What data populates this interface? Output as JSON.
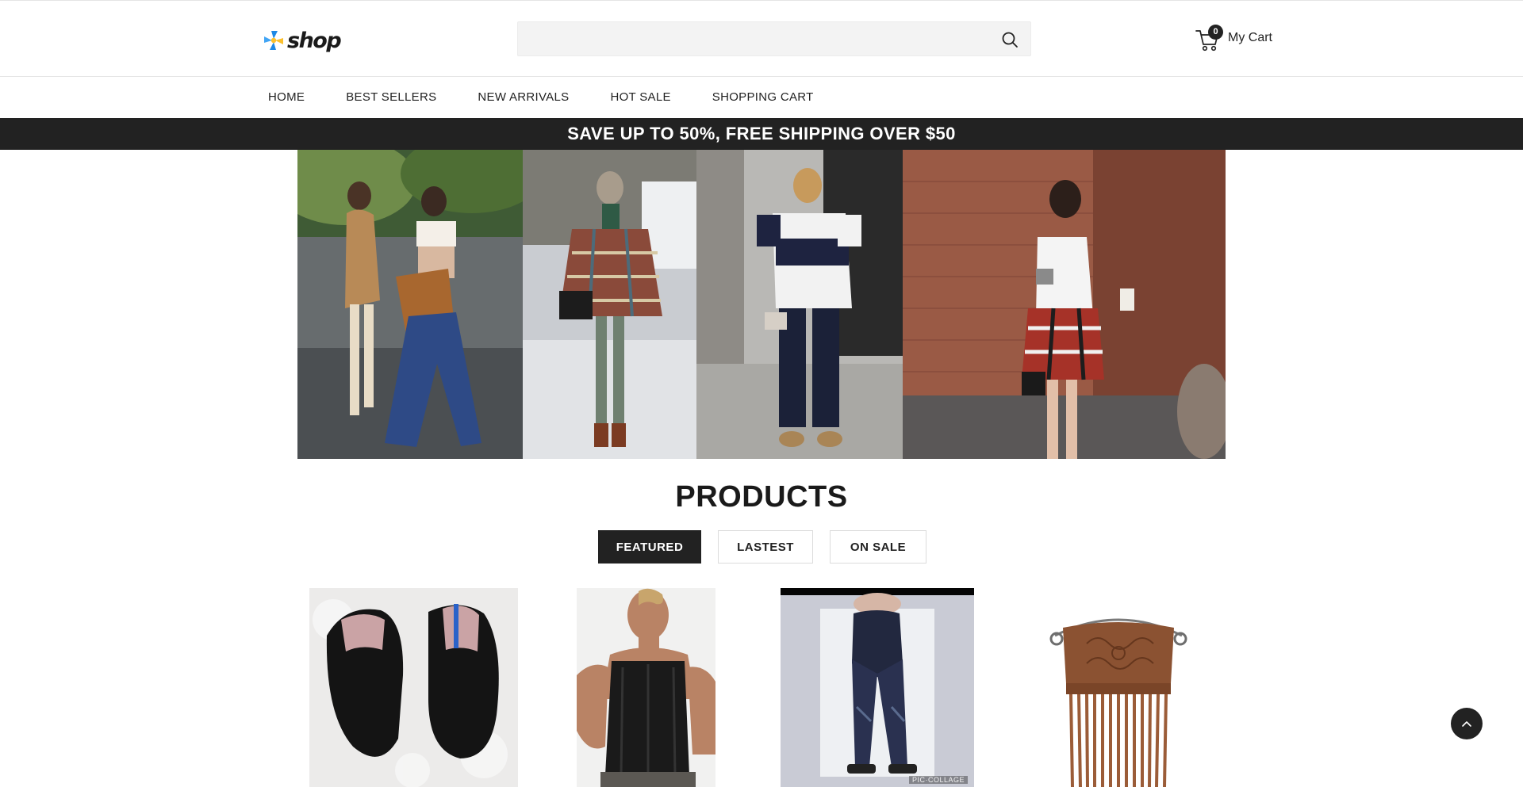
{
  "header": {
    "logo_text": "shop",
    "search": {
      "value": "",
      "placeholder": ""
    },
    "cart": {
      "count": "0",
      "label": "My Cart"
    }
  },
  "nav": {
    "items": [
      {
        "label": "HOME"
      },
      {
        "label": "BEST SELLERS"
      },
      {
        "label": "NEW ARRIVALS"
      },
      {
        "label": "HOT SALE"
      },
      {
        "label": "SHOPPING CART"
      }
    ]
  },
  "promo": {
    "text": "SAVE UP TO 50%, FREE SHIPPING OVER $50"
  },
  "products": {
    "title": "PRODUCTS",
    "tabs": [
      {
        "label": "FEATURED",
        "active": true
      },
      {
        "label": "LASTEST",
        "active": false
      },
      {
        "label": "ON SALE",
        "active": false
      }
    ],
    "watermark": "PIC·COLLAGE"
  },
  "icons": {
    "logo": "pinwheel-logo-icon",
    "search": "search-icon",
    "cart": "cart-icon",
    "back_to_top": "chevron-up-icon"
  },
  "colors": {
    "dark": "#222222",
    "promo_bg": "#222222",
    "logo_blue": "#1e88e5",
    "logo_yellow": "#fbc02d"
  }
}
